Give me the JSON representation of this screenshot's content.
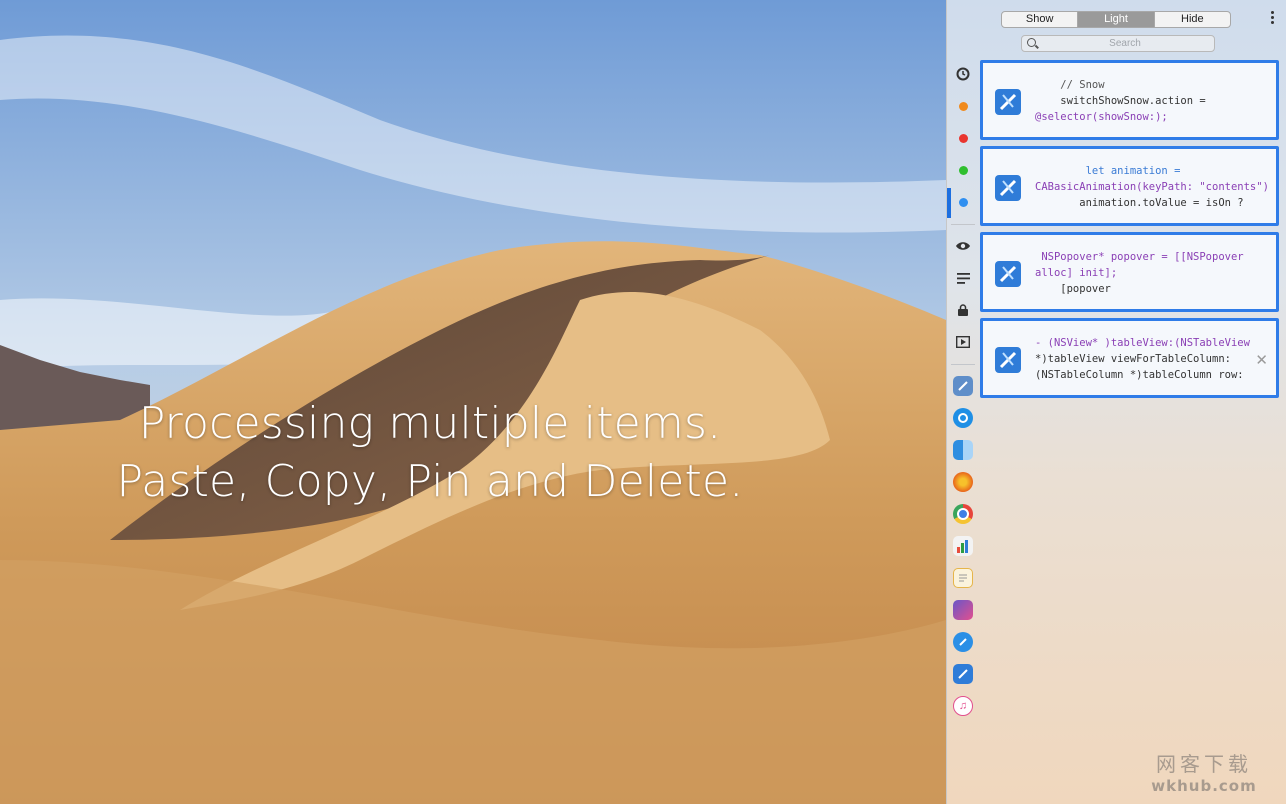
{
  "headline": {
    "line1": "Processing multiple items.",
    "line2": "Paste, Copy, Pin and Delete."
  },
  "panel": {
    "segments": [
      {
        "label": "Show",
        "active": false
      },
      {
        "label": "Light",
        "active": true
      },
      {
        "label": "Hide",
        "active": false
      }
    ],
    "search": {
      "placeholder": "Search"
    },
    "categories": [
      {
        "name": "history",
        "icon": "history-icon"
      },
      {
        "name": "orange",
        "color": "#f08a1d"
      },
      {
        "name": "red",
        "color": "#e9352f"
      },
      {
        "name": "green",
        "color": "#2fbf2f"
      },
      {
        "name": "blue",
        "color": "#2f8ff0"
      }
    ],
    "tools": [
      {
        "name": "eye",
        "icon": "eye-icon"
      },
      {
        "name": "text",
        "icon": "text-lines-icon"
      },
      {
        "name": "lock",
        "icon": "lock-icon"
      },
      {
        "name": "media",
        "icon": "play-media-icon"
      }
    ],
    "apps": [
      {
        "name": "xcode-alt",
        "icon": "xcode-icon",
        "color": "#5f8ec9"
      },
      {
        "name": "clipboard-app",
        "icon": "clipboard-app-icon",
        "color": "#1f8fe5"
      },
      {
        "name": "finder",
        "icon": "finder-icon",
        "color": "#3b8fe0"
      },
      {
        "name": "firefox",
        "icon": "firefox-icon",
        "color": "#e8651a"
      },
      {
        "name": "chrome",
        "icon": "chrome-icon",
        "color": "#e7453b"
      },
      {
        "name": "numbers",
        "icon": "numbers-icon",
        "color": "#2d9c43"
      },
      {
        "name": "notes",
        "icon": "textedit-icon",
        "color": "#e6b54a"
      },
      {
        "name": "sketch",
        "icon": "editor-icon",
        "color": "#6a57c8"
      },
      {
        "name": "safari",
        "icon": "safari-icon",
        "color": "#2b8fe6"
      },
      {
        "name": "xcode",
        "icon": "xcode-icon",
        "color": "#2f7cd8"
      },
      {
        "name": "itunes",
        "icon": "itunes-icon",
        "color": "#e24f8e"
      }
    ],
    "items": [
      {
        "lines": [
          "    // Snow",
          "    switchShowSnow.action =",
          "@selector(showSnow:);"
        ]
      },
      {
        "lines": [
          "        let animation =",
          "CABasicAnimation(keyPath: \"contents\")",
          "       animation.toValue = isOn ?"
        ]
      },
      {
        "lines": [
          " NSPopover* popover = [[NSPopover",
          "alloc] init];",
          "    [popover"
        ]
      },
      {
        "lines": [
          "- (NSView* )tableView:(NSTableView",
          "*)tableView viewForTableColumn:",
          "(NSTableColumn *)tableColumn row:"
        ],
        "closable": true
      }
    ]
  },
  "watermark": {
    "line1": "网客下载",
    "line2": "wkhub.com"
  }
}
